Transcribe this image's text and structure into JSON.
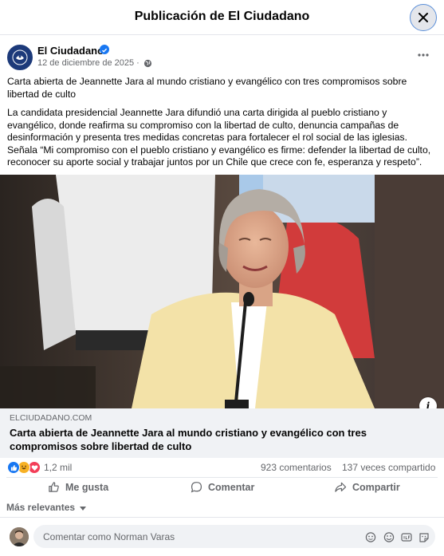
{
  "dialog": {
    "title": "Publicación de El Ciudadano"
  },
  "post": {
    "page_name": "El Ciudadano",
    "date": "12 de diciembre de 2025 ·",
    "headline": "Carta abierta de Jeannette Jara al mundo cristiano y evangélico con tres compromisos sobre libertad de culto",
    "body": "La candidata presidencial Jeannette Jara difundió una carta dirigida al pueblo cristiano y evangélico, donde reafirma su compromiso con la libertad de culto, denuncia campañas de desinformación y presenta tres medidas concretas para fortalecer el rol social de las iglesias. Señala “Mi compromiso con el pueblo cristiano y evangélico es firme: defender la libertad de culto, reconocer su aporte social y trabajar juntos por un Chile que crece con fe, esperanza y respeto”."
  },
  "link_card": {
    "domain": "ELCIUDADANO.COM",
    "title": "Carta abierta de Jeannette Jara al mundo cristiano y evangélico con tres compromisos sobre libertad de culto"
  },
  "stats": {
    "reactions": "1,2 mil",
    "comments": "923 comentarios",
    "shares": "137 veces compartido"
  },
  "actions": {
    "like": "Me gusta",
    "comment": "Comentar",
    "share": "Compartir"
  },
  "sort": {
    "label": "Más relevantes"
  },
  "composer": {
    "placeholder": "Comentar como Norman Varas"
  },
  "colors": {
    "accent": "#1877f2",
    "like": "#1877f2",
    "love": "#f33e58",
    "haha": "#f7b125",
    "secondary_text": "#65676b",
    "card_bg": "#f0f2f5"
  },
  "icons": [
    "close-icon",
    "verified-icon",
    "globe-icon",
    "more-icon",
    "info-icon",
    "like-reaction-icon",
    "haha-reaction-icon",
    "love-reaction-icon",
    "thumbs-up-icon",
    "comment-icon",
    "share-icon",
    "sticker-icon",
    "emoji-icon",
    "gif-icon",
    "sticker-face-icon"
  ]
}
